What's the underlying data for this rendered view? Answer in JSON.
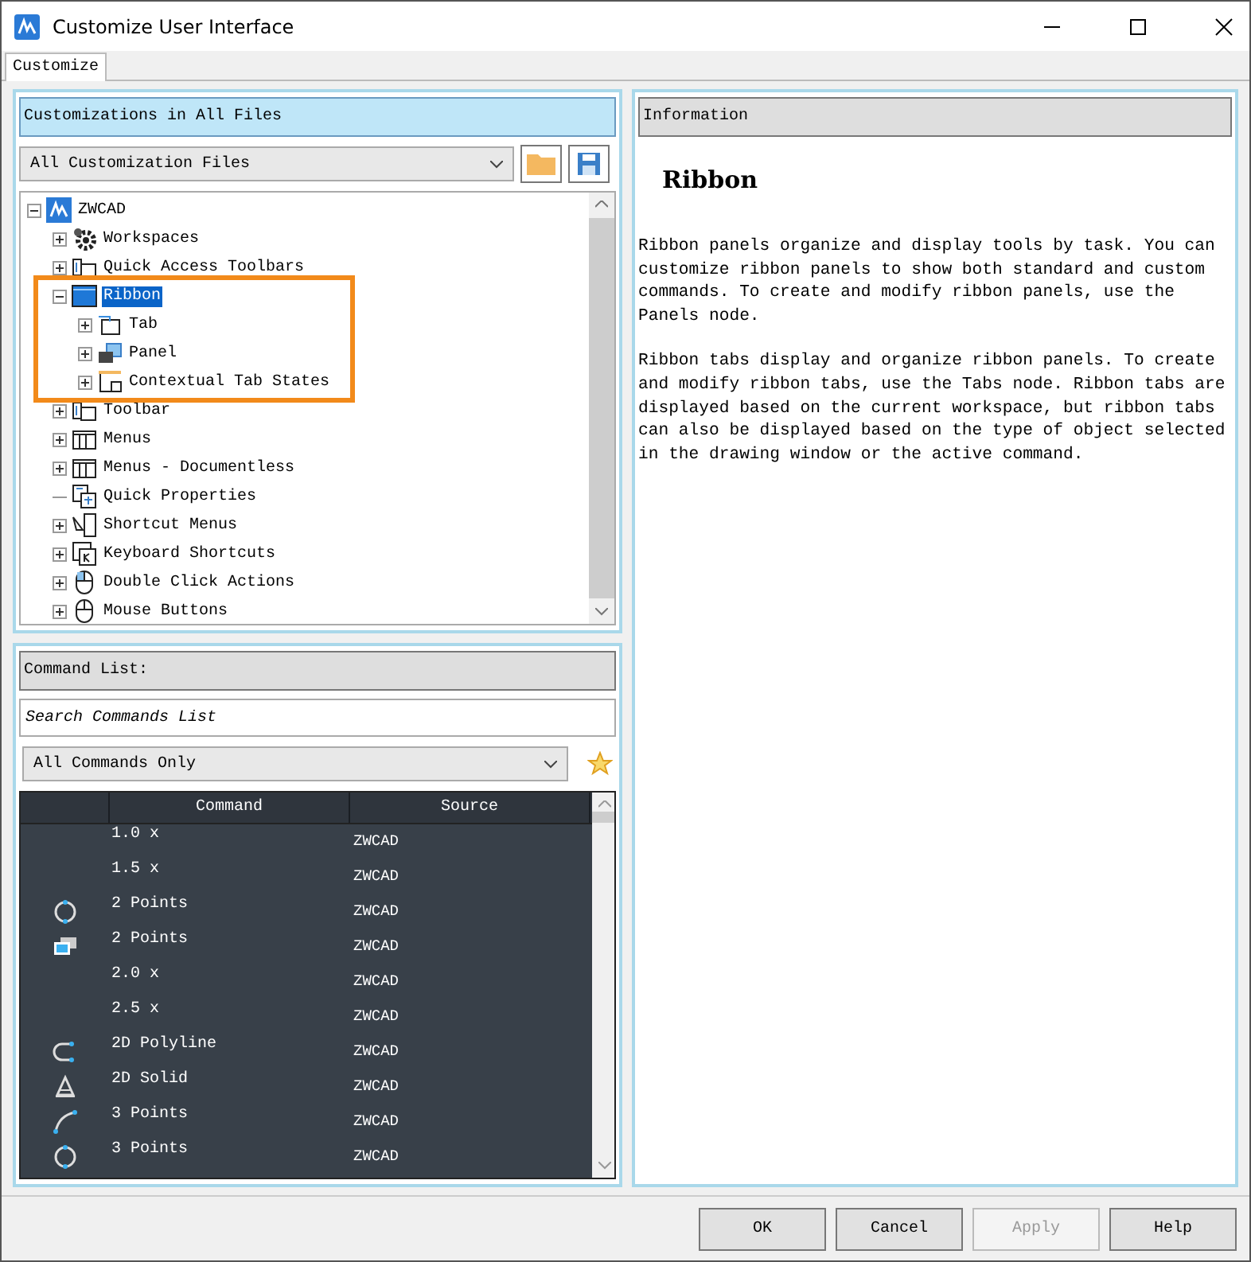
{
  "window": {
    "title": "Customize User Interface"
  },
  "tabs": [
    {
      "label": "Customize",
      "selected": true
    }
  ],
  "customizations": {
    "header": "Customizations in All Files",
    "file_select": "All Customization Files",
    "tree": [
      {
        "label": "ZWCAD",
        "kind": "app",
        "expanded": true,
        "selected": false,
        "highlighted": false,
        "children": [
          {
            "label": "Workspaces",
            "kind": "gear",
            "expanded": false,
            "selected": false,
            "highlighted": false
          },
          {
            "label": "Quick Access Toolbars",
            "kind": "quick",
            "expanded": false,
            "selected": false,
            "highlighted": false
          },
          {
            "label": "Ribbon",
            "kind": "ribbon",
            "expanded": true,
            "selected": true,
            "highlighted": true,
            "children": [
              {
                "label": "Tab",
                "kind": "tab",
                "expanded": false,
                "selected": false,
                "highlighted": false
              },
              {
                "label": "Panel",
                "kind": "panel",
                "expanded": false,
                "selected": false,
                "highlighted": false
              },
              {
                "label": "Contextual Tab States",
                "kind": "context",
                "expanded": false,
                "selected": false,
                "highlighted": false
              }
            ]
          },
          {
            "label": "Toolbar",
            "kind": "toolbar",
            "expanded": false,
            "selected": false,
            "highlighted": false
          },
          {
            "label": "Menus",
            "kind": "menu",
            "expanded": false,
            "selected": false,
            "highlighted": false
          },
          {
            "label": "Menus - Documentless",
            "kind": "menu",
            "expanded": false,
            "selected": false,
            "highlighted": false
          },
          {
            "label": "Quick Properties",
            "kind": "props",
            "selected": false,
            "highlighted": false
          },
          {
            "label": "Shortcut Menus",
            "kind": "shortcut",
            "expanded": false,
            "selected": false,
            "highlighted": false
          },
          {
            "label": "Keyboard Shortcuts",
            "kind": "keyboard",
            "expanded": false,
            "selected": false,
            "highlighted": false
          },
          {
            "label": "Double Click Actions",
            "kind": "mouse",
            "expanded": false,
            "selected": false,
            "highlighted": false
          },
          {
            "label": "Mouse Buttons",
            "kind": "mouse2",
            "expanded": false,
            "selected": false,
            "highlighted": false
          }
        ]
      }
    ]
  },
  "command_list": {
    "header": "Command List:",
    "search": {
      "placeholder": "Search Commands List"
    },
    "filter": "All Commands Only",
    "table": {
      "columns": [
        "Command",
        "Source"
      ],
      "rows": [
        {
          "kind": "none",
          "command": "1.0 x",
          "source": "ZWCAD"
        },
        {
          "kind": "none",
          "command": "1.5 x",
          "source": "ZWCAD"
        },
        {
          "kind": "circle",
          "command": "2 Points",
          "source": "ZWCAD"
        },
        {
          "kind": "view",
          "command": "2 Points",
          "source": "ZWCAD"
        },
        {
          "kind": "none",
          "command": "2.0 x",
          "source": "ZWCAD"
        },
        {
          "kind": "none",
          "command": "2.5 x",
          "source": "ZWCAD"
        },
        {
          "kind": "polyline",
          "command": "2D Polyline",
          "source": "ZWCAD"
        },
        {
          "kind": "solid",
          "command": "2D Solid",
          "source": "ZWCAD"
        },
        {
          "kind": "arc",
          "command": "3 Points",
          "source": "ZWCAD"
        },
        {
          "kind": "circle",
          "command": "3 Points",
          "source": "ZWCAD"
        }
      ]
    }
  },
  "information": {
    "header": "Information",
    "title": "Ribbon",
    "paragraphs": [
      "Ribbon panels organize and display tools by task. You can customize ribbon panels to show both standard and custom commands. To create and modify ribbon panels, use the Panels node.",
      "Ribbon tabs display and organize ribbon panels. To create and modify ribbon tabs, use the Tabs node. Ribbon tabs are displayed based on the current workspace, but ribbon tabs can also be displayed based on the type of object selected in the drawing window or the active command."
    ]
  },
  "buttons": [
    {
      "label": "OK",
      "disabled": false
    },
    {
      "label": "Cancel",
      "disabled": false
    },
    {
      "label": "Apply",
      "disabled": true
    },
    {
      "label": "Help",
      "disabled": false
    }
  ]
}
